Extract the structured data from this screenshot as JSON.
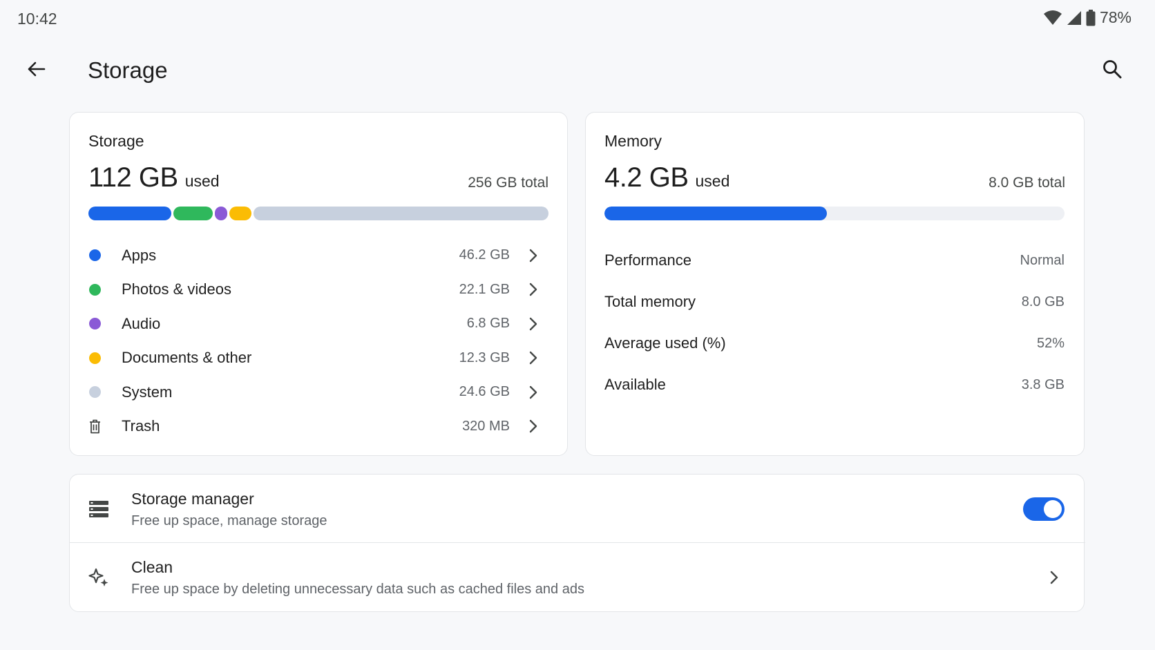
{
  "status_bar": {
    "time": "10:42",
    "battery_percent": "78%",
    "icons": [
      "wifi-icon",
      "cellular-signal-icon",
      "battery-icon"
    ]
  },
  "app_bar": {
    "title": "Storage",
    "back_icon": "arrow-back-icon",
    "search_icon": "search-icon"
  },
  "storage_card": {
    "title": "Storage",
    "used_amount": "112 GB",
    "used_suffix": "used",
    "total": "256 GB total",
    "segments": [
      {
        "name": "Apps",
        "gb": 46.2,
        "color": "#1a66e8"
      },
      {
        "name": "Photos & videos",
        "gb": 22.1,
        "color": "#2fb85c"
      },
      {
        "name": "Audio",
        "gb": 6.8,
        "color": "#8a5ad6"
      },
      {
        "name": "Documents & other",
        "gb": 12.3,
        "color": "#fbbc04"
      }
    ],
    "categories": [
      {
        "label": "Apps",
        "value": "46.2 GB",
        "color": "#1a66e8",
        "icon": "dot"
      },
      {
        "label": "Photos & videos",
        "value": "22.1 GB",
        "color": "#2fb85c",
        "icon": "dot"
      },
      {
        "label": "Audio",
        "value": "6.8 GB",
        "color": "#8a5ad6",
        "icon": "dot"
      },
      {
        "label": "Documents & other",
        "value": "12.3 GB",
        "color": "#fbbc04",
        "icon": "dot"
      },
      {
        "label": "System",
        "value": "24.6 GB",
        "color": "#c7d0de",
        "icon": "dot"
      },
      {
        "label": "Trash",
        "value": "320 MB",
        "color": "#444746",
        "icon": "trash-icon"
      }
    ]
  },
  "memory_card": {
    "title": "Memory",
    "used_amount": "4.2 GB",
    "used_suffix": "used",
    "total": "8.0 GB total",
    "used_fraction": 0.4838,
    "stats": [
      {
        "label": "Performance",
        "value": "Normal"
      },
      {
        "label": "Total memory",
        "value": "8.0 GB"
      },
      {
        "label": "Average used (%)",
        "value": "52%"
      },
      {
        "label": "Available",
        "value": "3.8 GB"
      }
    ]
  },
  "settings": {
    "storage_manager": {
      "title": "Storage manager",
      "subtitle": "Free up space, manage storage",
      "icon": "storage-manager-icon",
      "enabled": true
    },
    "clean": {
      "title": "Clean",
      "subtitle": "Free up space by deleting unnecessary data such as cached files and ads",
      "icon": "sparkle-icon"
    }
  },
  "colors": {
    "accent": "#1a66e8",
    "background": "#f7f8fa",
    "card": "#ffffff"
  }
}
